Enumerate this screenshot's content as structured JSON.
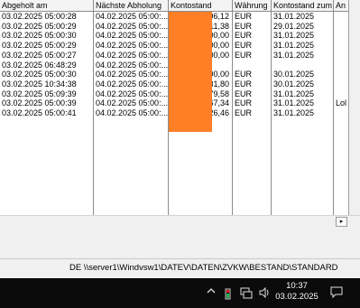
{
  "table": {
    "columns": [
      "Abgeholt am",
      "Nächste Abholung",
      "Kontostand",
      "Währung",
      "Kontostand zum",
      "An"
    ],
    "rows": [
      [
        "03.02.2025 05:00:28",
        "04.02.2025 05:00:...",
        "96,12",
        "EUR",
        "31.01.2025",
        ""
      ],
      [
        "03.02.2025 05:00:29",
        "04.02.2025 05:00:...",
        "11,38",
        "EUR",
        "29.01.2025",
        ""
      ],
      [
        "03.02.2025 05:00:30",
        "04.02.2025 05:00:...",
        "00,00",
        "EUR",
        "31.01.2025",
        ""
      ],
      [
        "03.02.2025 05:00:29",
        "04.02.2025 05:00:...",
        "00,00",
        "EUR",
        "31.01.2025",
        ""
      ],
      [
        "03.02.2025 05:00:27",
        "04.02.2025 05:00:...",
        "00,00",
        "EUR",
        "31.01.2025",
        ""
      ],
      [
        "03.02.2025 06:48:29",
        "04.02.2025 05:00:...",
        "",
        "",
        "",
        ""
      ],
      [
        "03.02.2025 05:00:30",
        "04.02.2025 05:00:...",
        "00,00",
        "EUR",
        "30.01.2025",
        ""
      ],
      [
        "03.02.2025 10:34:38",
        "04.02.2025 05:00:...",
        "31,80",
        "EUR",
        "30.01.2025",
        ""
      ],
      [
        "03.02.2025 05:09:39",
        "04.02.2025 05:00:...",
        "79,58",
        "EUR",
        "31.01.2025",
        ""
      ],
      [
        "03.02.2025 05:00:39",
        "04.02.2025 05:00:...",
        "67,34",
        "EUR",
        "31.01.2025",
        "Lol"
      ],
      [
        "03.02.2025 05:00:41",
        "04.02.2025 05:00:...",
        "26,46",
        "EUR",
        "31.01.2025",
        ""
      ]
    ]
  },
  "hscroll": {
    "right_arrow": "▸"
  },
  "status": {
    "text": "DE   \\\\server1\\Windvsw1\\DATEV\\DATEN\\ZVKW\\BESTAND\\STANDARD"
  },
  "taskbar": {
    "time": "10:37",
    "date": "03.02.2025",
    "icons": [
      "chevron-up-icon",
      "battery-icon",
      "network-icon",
      "volume-icon",
      "notification-icon"
    ]
  },
  "colors": {
    "redaction": "#ff7f27",
    "taskbar": "#0b0b0b"
  }
}
